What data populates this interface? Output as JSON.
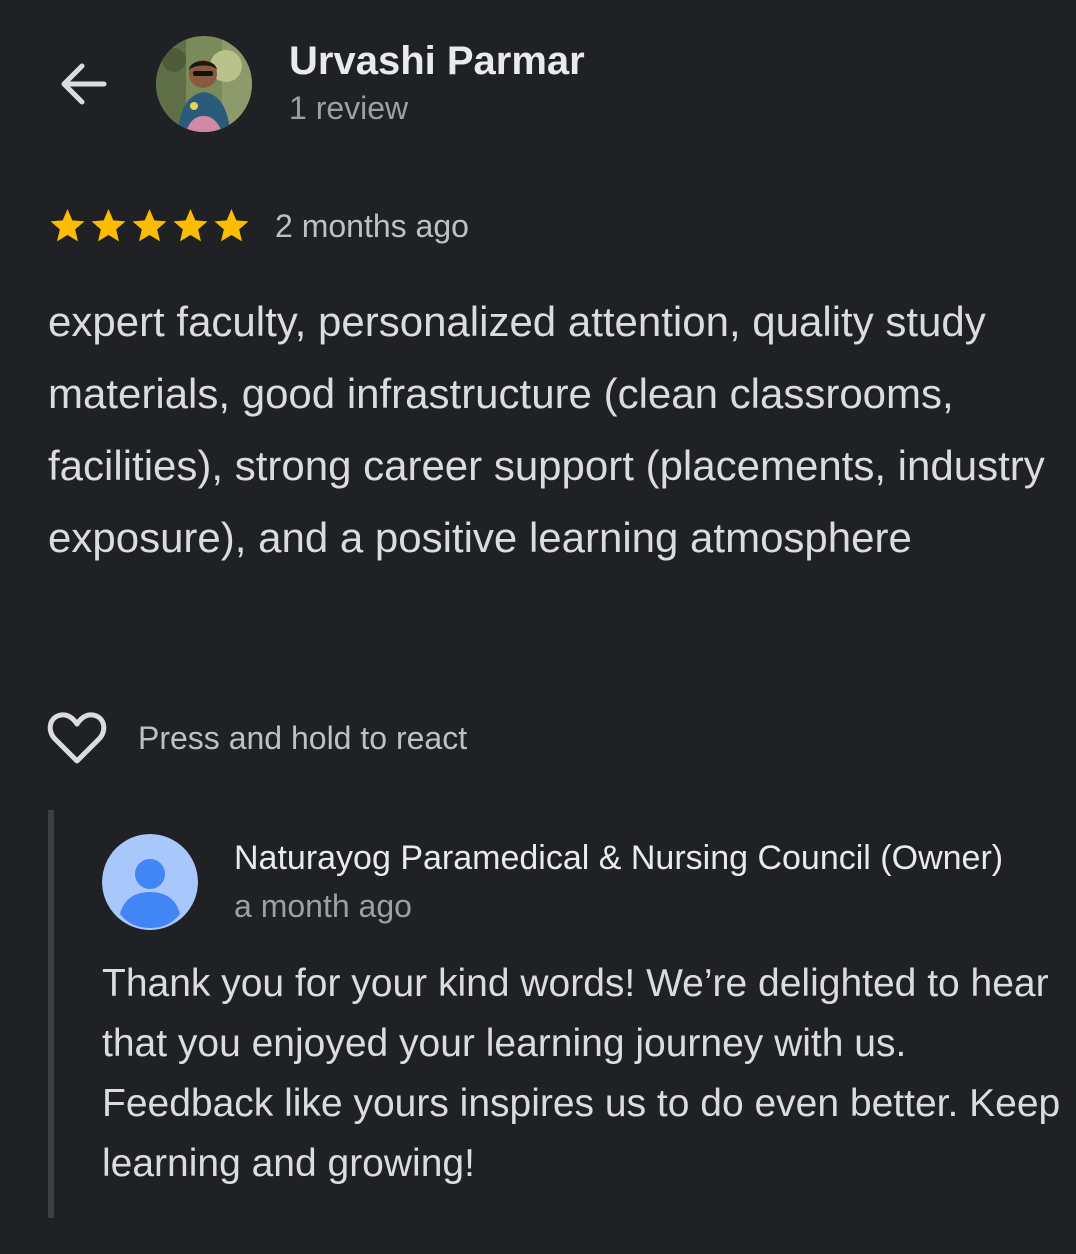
{
  "review": {
    "reviewer_name": "Urvashi Parmar",
    "review_count": "1 review",
    "rating": 5,
    "rating_max": 5,
    "star_color": "#fbbc04",
    "date": "2 months ago",
    "text": "expert faculty, personalized attention, quality study materials, good infrastructure (clean classrooms, facilities), strong career support (placements, industry exposure), and a positive learning atmosphere"
  },
  "react": {
    "icon": "heart-outline-icon",
    "label": "Press and hold to react"
  },
  "owner_reply": {
    "name": "Naturayog Paramedical & Nursing Council (Owner)",
    "date": "a month ago",
    "text": "Thank you for your kind words! We’re delighted to hear that you enjoyed your learning journey with us. Feedback like yours inspires us to do even better. Keep learning and growing!",
    "avatar_icon": "default-person-avatar",
    "avatar_bg": "#a8c7fa",
    "avatar_fg": "#4285f4"
  },
  "icons": {
    "back": "back-arrow-icon"
  }
}
